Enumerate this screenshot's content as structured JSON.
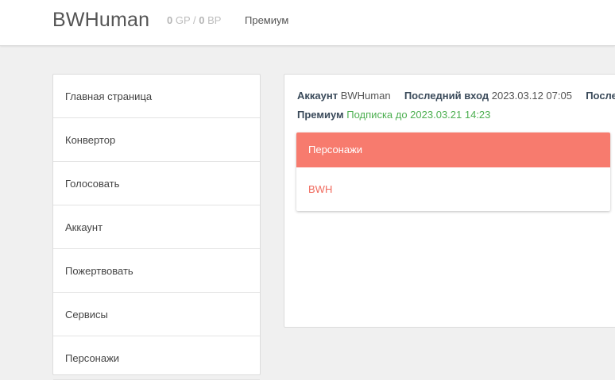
{
  "header": {
    "brand": "BWHuman",
    "gp_value": "0",
    "gp_unit": " GP / ",
    "bp_value": "0",
    "bp_unit": " BP",
    "premium_link": "Премиум"
  },
  "sidebar": {
    "items": [
      {
        "label": "Главная страница"
      },
      {
        "label": "Конвертор"
      },
      {
        "label": "Голосовать"
      },
      {
        "label": "Аккаунт"
      },
      {
        "label": "Пожертвовать"
      },
      {
        "label": "Сервисы"
      },
      {
        "label": "Персонажи"
      }
    ]
  },
  "account": {
    "account_label": "Аккаунт",
    "account_value": "BWHuman",
    "last_login_label": "Последний вход",
    "last_login_value": "2023.03.12 07:05",
    "truncated_label": "Последн",
    "premium_label": "Премиум",
    "premium_value": "Подписка до 2023.03.21 14:23"
  },
  "characters": {
    "title": "Персонажи",
    "items": [
      "BWH"
    ]
  },
  "colors": {
    "accent": "#f77b6e",
    "link": "#f06b5e",
    "success": "#4caf50"
  }
}
